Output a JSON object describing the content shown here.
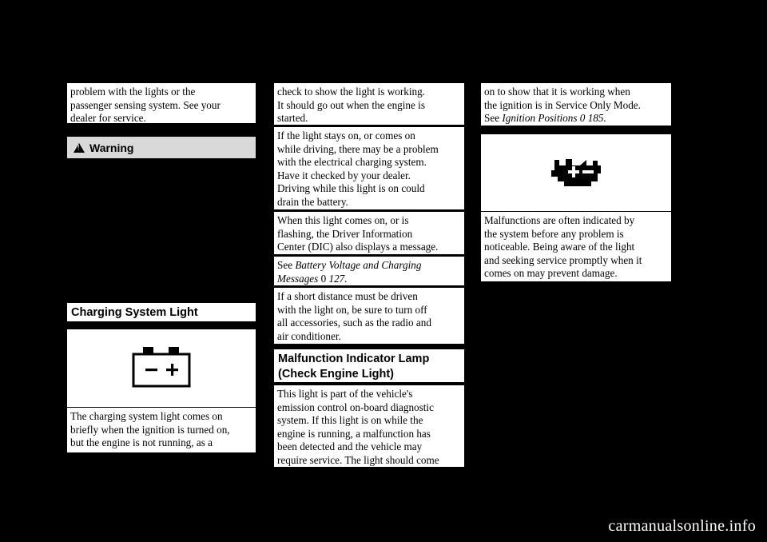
{
  "page": {
    "background_color": "#000000",
    "watermark": "carmanualsonline.info"
  },
  "columns": {
    "left": {
      "intro_text": "problem with the lights or the\npassenger sensing system. See your\ndealer for service.",
      "warning": {
        "label": "Warning",
        "icon": "warning-triangle-icon",
        "background_color": "#d9d9d9"
      },
      "heading": "Charging System Light",
      "figure_icon": "battery-icon",
      "figure_labels": {
        "minus": "−",
        "plus": "+"
      },
      "body_text": "The charging system light comes on\nbriefly when the ignition is turned on,\nbut the engine is not running, as a"
    },
    "middle": {
      "blocks": [
        "check to show the light is working.\nIt should go out when the engine is\nstarted.",
        "If the light stays on, or comes on\nwhile driving, there may be a problem\nwith the electrical charging system.\nHave it checked by your dealer.\nDriving while this light is on could\ndrain the battery.",
        "When this light comes on, or is\nflashing, the Driver Information\nCenter (DIC) also displays a message."
      ],
      "reference": {
        "lead": "See",
        "italic_title": "Battery Voltage and Charging\nMessages",
        "page_symbol": "0",
        "page_number": "127",
        "trailing": "."
      },
      "after_reference": "If a short distance must be driven\nwith the light on, be sure to turn off\nall accessories, such as the radio and\nair conditioner.",
      "heading": "Malfunction Indicator Lamp\n(Check Engine Light)",
      "body_text": "This light is part of the vehicle's\nemission control on-board diagnostic\nsystem. If this light is on while the\nengine is running, a malfunction has\nbeen detected and the vehicle may\nrequire service. The light should come"
    },
    "right": {
      "top_text_lead": "on to show that it is working when\nthe ignition is in Service Only Mode.\nSee ",
      "top_text_italic": "Ignition Positions",
      "top_text_symbol": "0",
      "top_text_page": "185",
      "top_text_end": ".",
      "figure_icon": "check-engine-icon",
      "body_text": "Malfunctions are often indicated by\nthe system before any problem is\nnoticeable. Being aware of the light\nand seeking service promptly when it\ncomes on may prevent damage."
    }
  }
}
